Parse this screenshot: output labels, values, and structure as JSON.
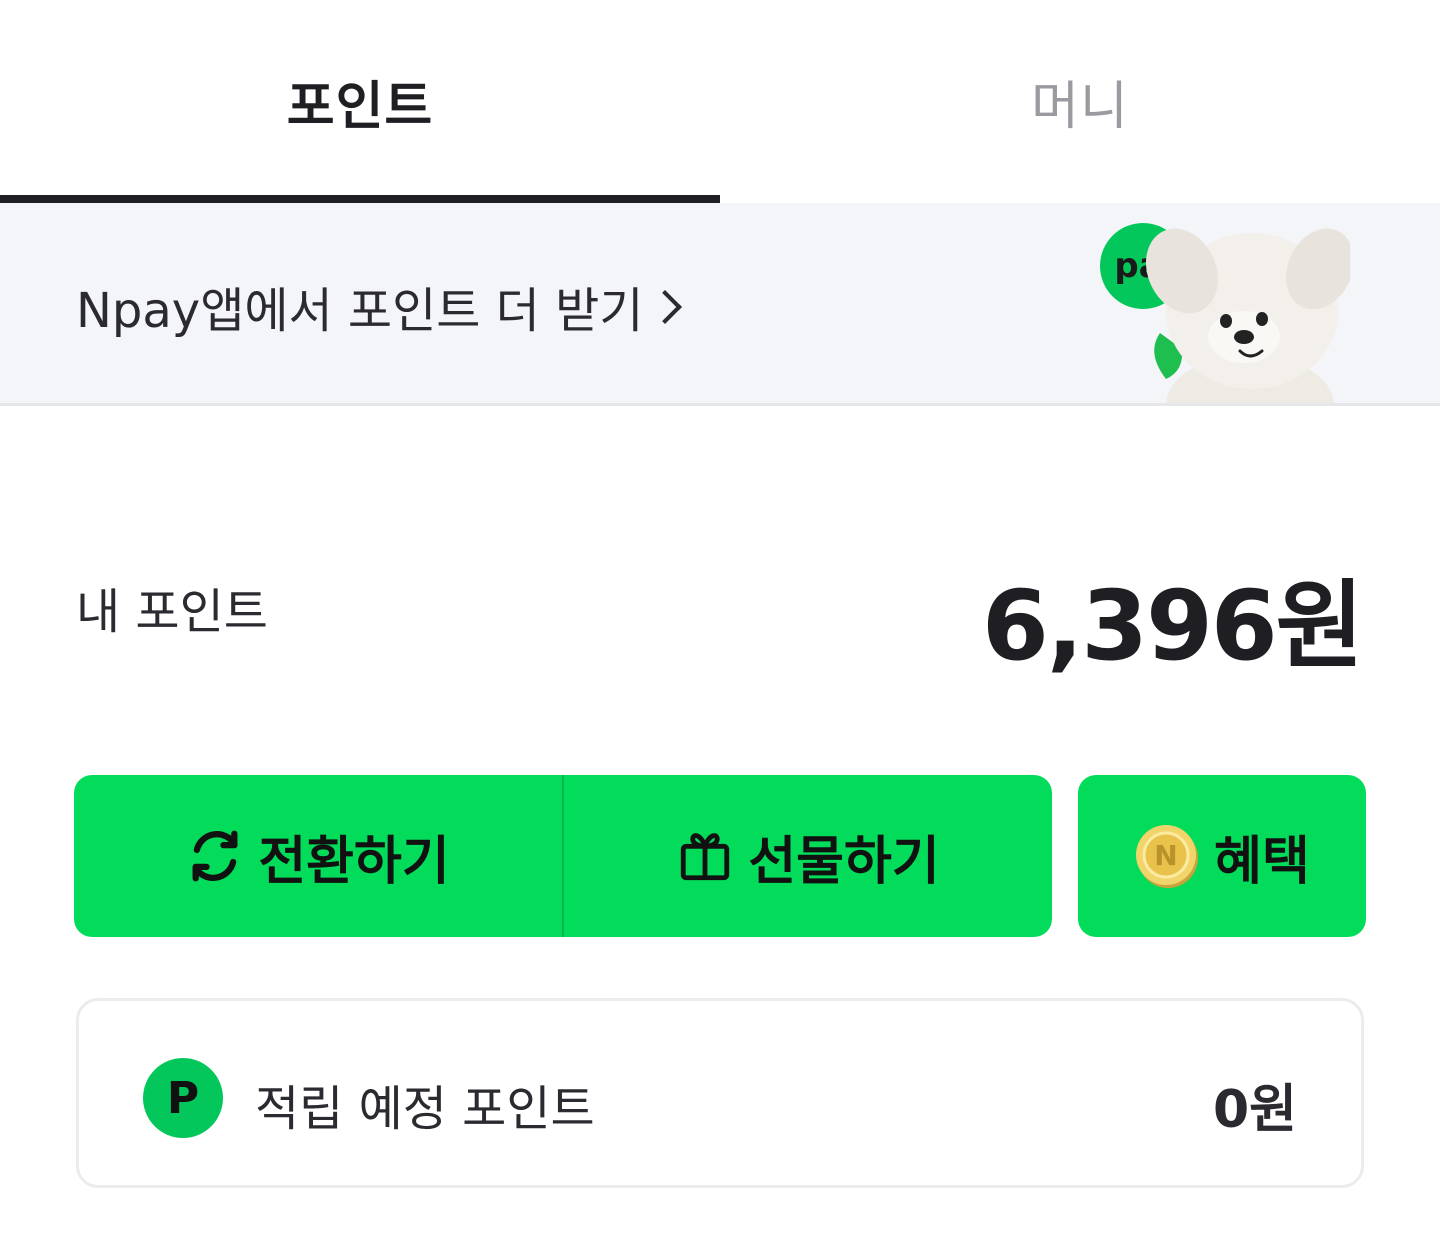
{
  "tabs": [
    {
      "label": "포인트",
      "active": true
    },
    {
      "label": "머니",
      "active": false
    }
  ],
  "banner": {
    "text": "Npay앱에서 포인트 더 받기",
    "badge_text": "pa"
  },
  "points": {
    "label": "내 포인트",
    "amount": "6,396원"
  },
  "actions": {
    "convert_label": "전환하기",
    "gift_label": "선물하기",
    "benefit_label": "혜택"
  },
  "pending": {
    "badge": "P",
    "label": "적립 예정 포인트",
    "value": "0원"
  },
  "colors": {
    "accent_green": "#03dc5a",
    "badge_green": "#03c75a",
    "text_dark": "#1e1e23",
    "tab_inactive": "#9a9aa0",
    "banner_bg": "#f4f5f8"
  },
  "icons": [
    "refresh-icon",
    "gift-icon",
    "n-coin-icon",
    "chevron-right-icon"
  ]
}
